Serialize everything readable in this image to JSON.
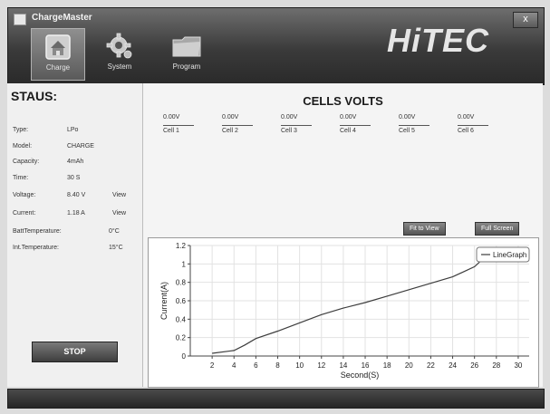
{
  "app": {
    "title": "ChargeMaster",
    "close_label": "x",
    "brand": "HiTEC"
  },
  "toolbar": {
    "charge_label": "Charge",
    "system_label": "System",
    "program_label": "Program"
  },
  "status": {
    "title": "STAUS:",
    "type_label": "Type:",
    "type_value": "LPo",
    "model_label": "Model:",
    "model_value": "CHARGE",
    "capacity_label": "Capacity:",
    "capacity_value": "4mAh",
    "time_label": "Time:",
    "time_value": "30 S",
    "voltage_label": "Voltage:",
    "voltage_value": "8.40 V",
    "voltage_view": "View",
    "current_label": "Current:",
    "current_value": "1.18 A",
    "current_view": "View",
    "batt_temp_label": "BattTemperature:",
    "batt_temp_value": "0°C",
    "int_temp_label": "Int.Temperature:",
    "int_temp_value": "15°C",
    "stop_label": "STOP"
  },
  "cells": {
    "title": "CELLS VOLTS",
    "items": [
      {
        "name": "Cell 1",
        "value": "0.00V"
      },
      {
        "name": "Cell 2",
        "value": "0.00V"
      },
      {
        "name": "Cell 3",
        "value": "0.00V"
      },
      {
        "name": "Cell 4",
        "value": "0.00V"
      },
      {
        "name": "Cell 5",
        "value": "0.00V"
      },
      {
        "name": "Cell 6",
        "value": "0.00V"
      }
    ]
  },
  "chart_controls": {
    "fit_label": "Fit to View",
    "fullscreen_label": "Full Screen"
  },
  "statusbar": {
    "text": ""
  },
  "colors": {
    "line": "#3d3d3d",
    "grid": "#e2e2e2"
  },
  "chart_data": {
    "type": "line",
    "xlabel": "Second(S)",
    "ylabel": "Current(A)",
    "xlim": [
      0,
      31
    ],
    "ylim": [
      0,
      1.2
    ],
    "xticks": [
      2,
      4,
      6,
      8,
      10,
      12,
      14,
      16,
      18,
      20,
      22,
      24,
      26,
      28,
      30
    ],
    "yticks": [
      0,
      0.2,
      0.4,
      0.6,
      0.8,
      1,
      1.2
    ],
    "ytick_labels": [
      "0",
      "0.2",
      "0.4",
      "0.6",
      "0.8",
      "1",
      "1.2"
    ],
    "grid": true,
    "legend_position": "top-right",
    "series": [
      {
        "name": "LineGraph",
        "x": [
          2,
          4,
          5,
          6,
          8,
          10,
          12,
          14,
          16,
          18,
          20,
          22,
          24,
          26,
          27,
          28,
          30
        ],
        "y": [
          0.03,
          0.06,
          0.12,
          0.19,
          0.27,
          0.36,
          0.45,
          0.52,
          0.58,
          0.65,
          0.72,
          0.79,
          0.86,
          0.97,
          1.08,
          1.13,
          1.13
        ]
      }
    ]
  }
}
